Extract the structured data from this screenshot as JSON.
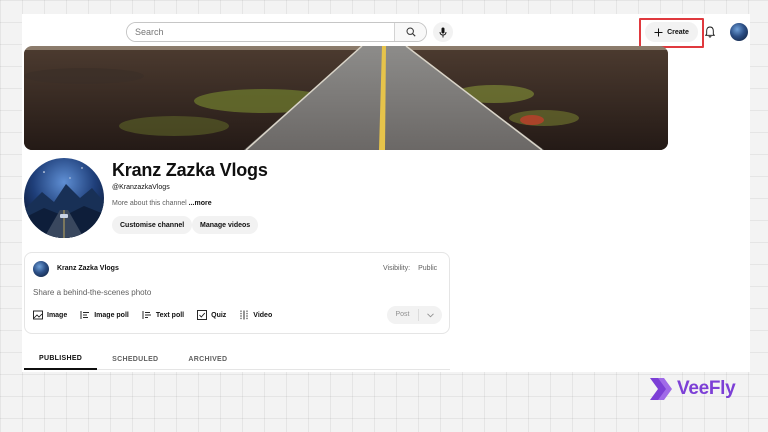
{
  "header": {
    "search_placeholder": "Search",
    "create_label": "Create"
  },
  "channel": {
    "name": "Kranz Zazka Vlogs",
    "handle": "@KranzazkaVlogs",
    "about_text": "More about this channel",
    "about_more": "...more",
    "customise_label": "Customise channel",
    "manage_label": "Manage videos"
  },
  "post_card": {
    "author": "Kranz Zazka Vlogs",
    "visibility_label": "Visibility:",
    "visibility_value": "Public",
    "prompt": "Share a behind-the-scenes photo",
    "tools": [
      "Image",
      "Image poll",
      "Text poll",
      "Quiz",
      "Video"
    ],
    "post_label": "Post"
  },
  "tabs": [
    "PUBLISHED",
    "SCHEDULED",
    "ARCHIVED"
  ],
  "watermark": {
    "text": "VeeFly"
  },
  "colors": {
    "highlight": "#e0393e",
    "brand_purple": "#7c3fd6"
  }
}
